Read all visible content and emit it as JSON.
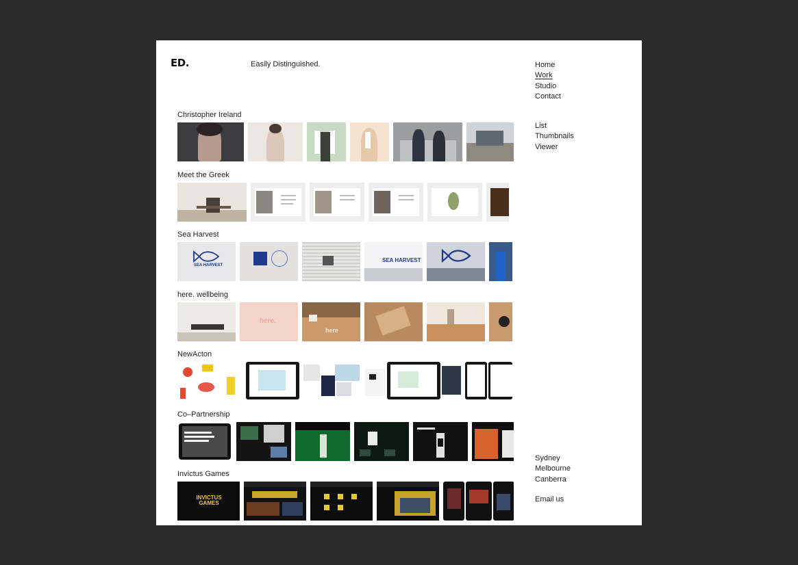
{
  "brand": {
    "logo": "ED.",
    "tagline": "Easily Distinguished."
  },
  "nav": {
    "items": [
      "Home",
      "Work",
      "Studio",
      "Contact"
    ],
    "active": "Work"
  },
  "views": [
    "List",
    "Thumbnails",
    "Viewer"
  ],
  "cities": [
    "Sydney",
    "Melbourne",
    "Canberra"
  ],
  "contact": {
    "email_label": "Email us"
  },
  "projects": [
    {
      "title": "Christopher Ireland",
      "thumb_labels": []
    },
    {
      "title": "Meet the Greek",
      "thumb_labels": []
    },
    {
      "title": "Sea Harvest",
      "thumb_labels": [
        "SEA HARVEST",
        "SEA HARVEST"
      ]
    },
    {
      "title": "here. wellbeing",
      "thumb_labels": [
        "here.",
        "here"
      ]
    },
    {
      "title": "NewActon",
      "thumb_labels": []
    },
    {
      "title": "Co–Partnership",
      "thumb_labels": []
    },
    {
      "title": "Invictus Games",
      "thumb_labels": [
        "INVICTUS GAMES"
      ]
    }
  ],
  "colors": {
    "backdrop": "#2b2b2b",
    "page": "#ffffff",
    "text": "#222222"
  }
}
